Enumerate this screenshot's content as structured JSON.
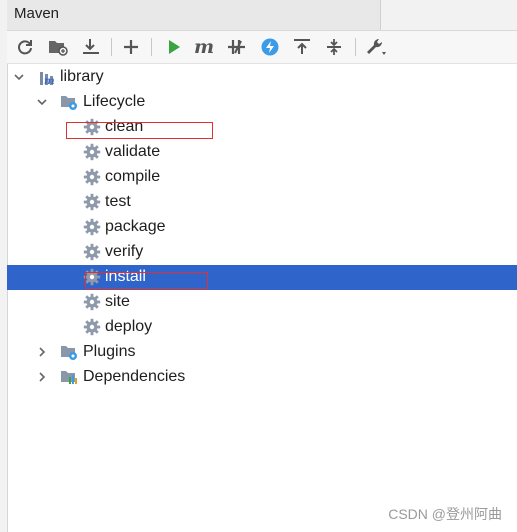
{
  "panel": {
    "title": "Maven"
  },
  "toolbar": {
    "buttons": [
      {
        "name": "reload-icon"
      },
      {
        "name": "add-folder-icon"
      },
      {
        "name": "download-icon"
      },
      {
        "name": "plus-icon"
      },
      {
        "name": "run-icon",
        "color": "#3aa342"
      },
      {
        "name": "maven-m-icon"
      },
      {
        "name": "skip-tests-icon"
      },
      {
        "name": "lightning-icon",
        "color": "#3b9be6"
      },
      {
        "name": "collapse-all-icon"
      },
      {
        "name": "expand-all-icon"
      },
      {
        "name": "wrench-icon"
      }
    ]
  },
  "tree": {
    "project": "library",
    "lifecycle": {
      "label": "Lifecycle",
      "goals": [
        "clean",
        "validate",
        "compile",
        "test",
        "package",
        "verify",
        "install",
        "site",
        "deploy"
      ],
      "selected": "install"
    },
    "plugins": "Plugins",
    "dependencies": "Dependencies"
  },
  "colors": {
    "selection": "#2f65ca",
    "annotation": "#e03030"
  },
  "watermark": "CSDN @登州阿曲"
}
